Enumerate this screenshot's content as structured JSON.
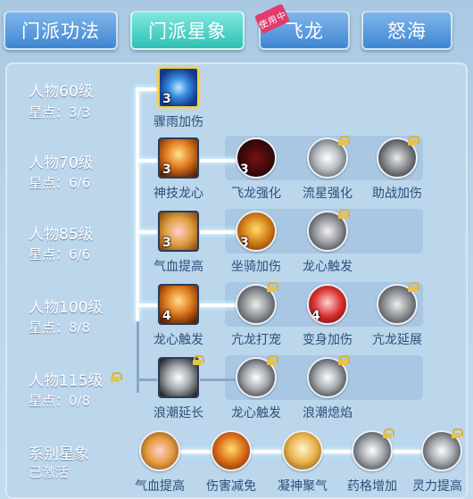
{
  "tabs": [
    {
      "label": "门派功法"
    },
    {
      "label": "门派星象"
    },
    {
      "label": "飞龙",
      "badge": "使用中"
    },
    {
      "label": "怒海"
    }
  ],
  "rows": [
    {
      "level": "人物60级",
      "stars": "星点：3/3",
      "skills": [
        {
          "name": "骤雨加伤",
          "count": "3"
        }
      ]
    },
    {
      "level": "人物70级",
      "stars": "星点：6/6",
      "skills": [
        {
          "name": "神技龙心",
          "count": "3"
        },
        {
          "name": "飞龙强化",
          "count": "3"
        },
        {
          "name": "流星强化",
          "count": ""
        },
        {
          "name": "助战加伤",
          "count": ""
        }
      ]
    },
    {
      "level": "人物85级",
      "stars": "星点：6/6",
      "skills": [
        {
          "name": "气血提高",
          "count": "3"
        },
        {
          "name": "坐骑加伤",
          "count": "3"
        },
        {
          "name": "龙心触发",
          "count": ""
        }
      ]
    },
    {
      "level": "人物100级",
      "stars": "星点：8/8",
      "skills": [
        {
          "name": "龙心触发",
          "count": "4"
        },
        {
          "name": "亢龙打宠",
          "count": ""
        },
        {
          "name": "变身加伤",
          "count": "4"
        },
        {
          "name": "亢龙延展",
          "count": ""
        }
      ]
    },
    {
      "level": "人物115级",
      "stars": "星点：0/8",
      "skills": [
        {
          "name": "浪潮延长",
          "count": ""
        },
        {
          "name": "龙心触发",
          "count": ""
        },
        {
          "name": "浪潮熄焰",
          "count": ""
        }
      ]
    }
  ],
  "series": {
    "title": "系别星象",
    "status": "已激活",
    "skills": [
      {
        "name": "气血提高"
      },
      {
        "name": "伤害减免"
      },
      {
        "name": "凝神聚气"
      },
      {
        "name": "药格增加"
      },
      {
        "name": "灵力提高"
      }
    ]
  },
  "colors": {
    "accent_teal": "#2fbfb3",
    "accent_blue": "#3f86d2",
    "badge": "#e23b6c",
    "lock": "#e8c24a"
  }
}
